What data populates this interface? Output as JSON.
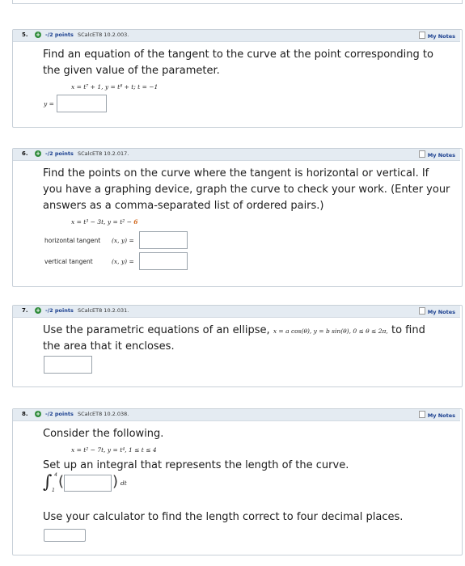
{
  "common": {
    "points": "-/2 points",
    "my_notes": "My Notes",
    "plus": "+"
  },
  "q5": {
    "number": "5.",
    "source": "SCalcET8 10.2.003.",
    "prompt_line1": "Find an equation of the tangent to the curve at the point corresponding to",
    "prompt_line2": "the given value of the parameter.",
    "equation": "x = t⁷ + 1,   y = t⁸ + t;   t = −1",
    "answer_label": "y ="
  },
  "q6": {
    "number": "6.",
    "source": "SCalcET8 10.2.017.",
    "prompt_line1": "Find the points on the curve where the tangent is horizontal or vertical. If",
    "prompt_line2": "you have a graphing device, graph the curve to check your work. (Enter your",
    "prompt_line3": "answers as a comma-separated list of ordered pairs.)",
    "equation_a": "x = t³ − 3t,   y = t² − ",
    "equation_b": "6",
    "horizontal_label": "horizontal tangent",
    "vertical_label": "vertical tangent",
    "xy_label": "(x, y) ="
  },
  "q7": {
    "number": "7.",
    "source": "SCalcET8 10.2.031.",
    "prompt_a": "Use the parametric equations of an ellipse,",
    "equation": "x = a cos(θ), y = b sin(θ), 0 ≤ θ ≤ 2π,",
    "prompt_b": "to find",
    "prompt_line2": "the area that it encloses."
  },
  "q8": {
    "number": "8.",
    "source": "SCalcET8 10.2.038.",
    "prompt_line1": "Consider the following.",
    "equation": "x = t² − 7t,   y = t⁴,   1 ≤ t ≤ 4",
    "prompt_line2": "Set up an integral that represents the length of the curve.",
    "integral_sign": "∫",
    "upper_limit": "4",
    "lower_limit": "1",
    "dt": "dt",
    "prompt_line3": "Use your calculator to find the length correct to four decimal places."
  }
}
